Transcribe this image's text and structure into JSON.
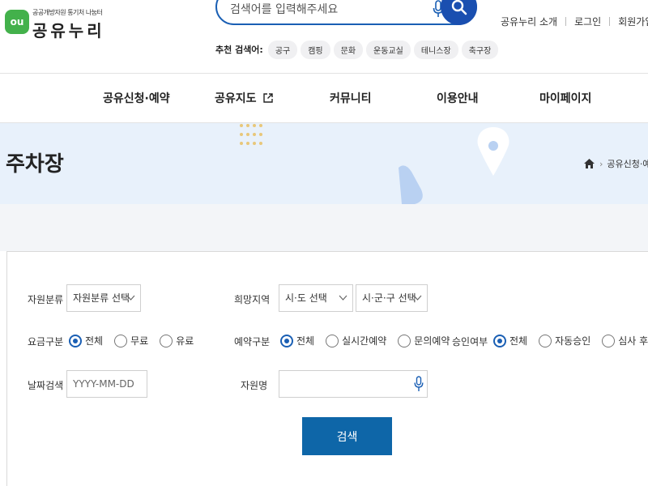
{
  "header": {
    "logo_mark": "ou",
    "logo_subtitle": "공공개방자원 통기처 나눔터",
    "logo_name": "공유누리",
    "search": {
      "placeholder": "검색어를 입력해주세요"
    },
    "recommend_label": "추천 검색어:",
    "recommend_tags": [
      "공구",
      "캠핑",
      "문화",
      "운동교실",
      "테니스장",
      "축구장"
    ],
    "util_links": [
      "공유누리 소개",
      "로그인",
      "회원가입"
    ]
  },
  "gnb": [
    "공유신청·예약",
    "공유지도",
    "커뮤니티",
    "이용안내",
    "마이페이지"
  ],
  "banner": {
    "title": "주차장",
    "breadcrumb": "공유신청·예약"
  },
  "filters": {
    "resource_type": {
      "label": "자원분류",
      "value": "자원분류 선택"
    },
    "region": {
      "label": "희망지역",
      "sido": "시·도 선택",
      "sigungu": "시·군·구 선택"
    },
    "fee": {
      "label": "요금구분",
      "options": [
        "전체",
        "무료",
        "유료"
      ],
      "selected": 0
    },
    "reservation": {
      "label": "예약구분",
      "options": [
        "전체",
        "실시간예약",
        "문의예약"
      ],
      "selected": 0
    },
    "approval": {
      "label": "승인여부",
      "options": [
        "전체",
        "자동승인",
        "심사 후 승인"
      ],
      "selected": 0
    },
    "date": {
      "label": "날짜검색",
      "placeholder": "YYYY-MM-DD"
    },
    "name": {
      "label": "자원명",
      "placeholder": ""
    },
    "submit_label": "검색"
  },
  "colors": {
    "primary": "#1a5fb4",
    "brand_green": "#43b14b",
    "submit": "#0e66a8",
    "banner_bg": "#e8f1fb"
  }
}
